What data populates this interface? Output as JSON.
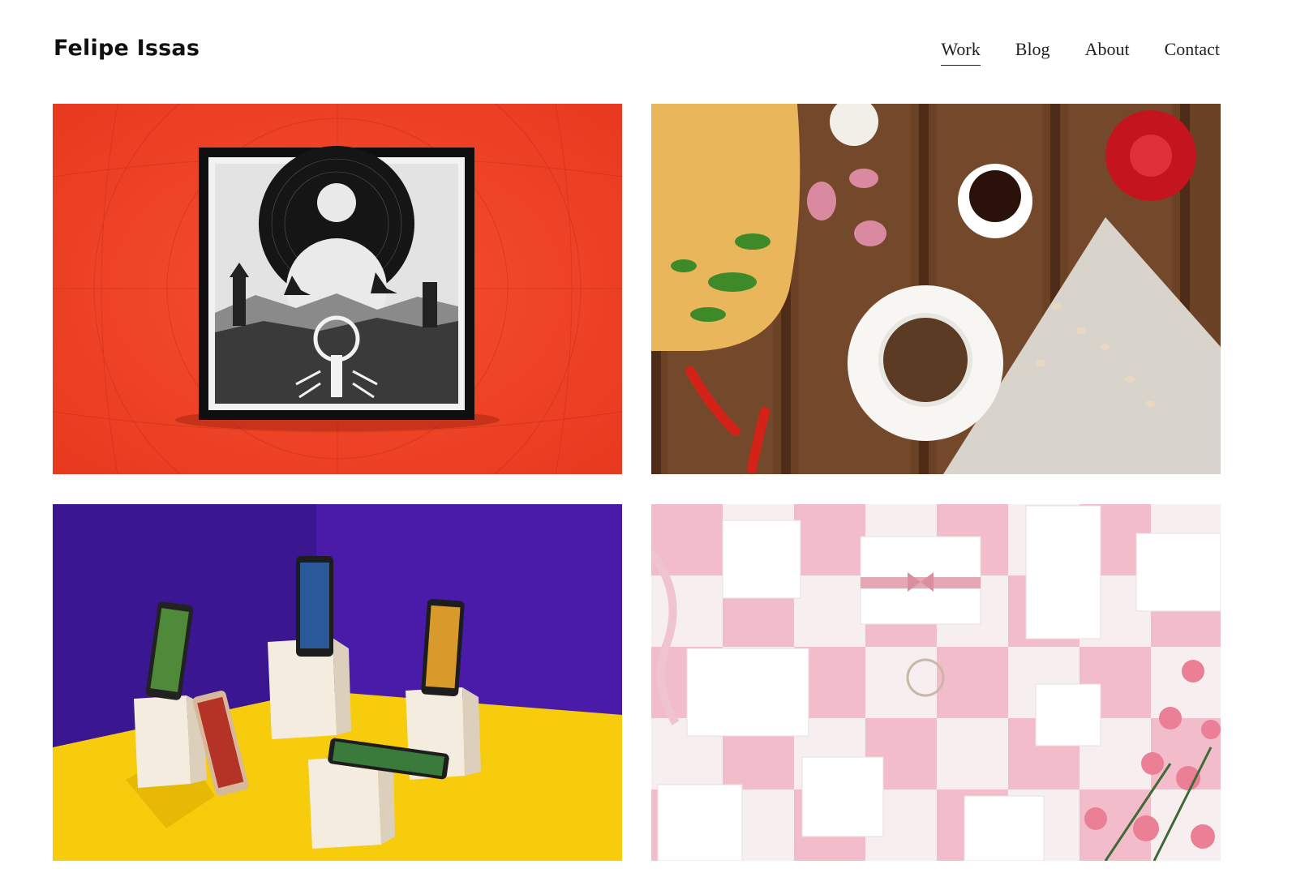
{
  "site": {
    "title": "Felipe Issas"
  },
  "nav": {
    "items": [
      {
        "label": "Work",
        "active": true
      },
      {
        "label": "Blog",
        "active": false
      },
      {
        "label": "About",
        "active": false
      },
      {
        "label": "Contact",
        "active": false
      }
    ]
  },
  "portfolio": {
    "tiles": [
      {
        "subject": "album cover on red background",
        "background": "#f2472a"
      },
      {
        "subject": "food flat lay on wooden table",
        "background": "#6b4226"
      },
      {
        "subject": "smartphones on white cubes",
        "background": "#4a1aa8"
      },
      {
        "subject": "white jewelry boxes on pink checkerboard",
        "background": "#f4c8d4"
      }
    ]
  }
}
